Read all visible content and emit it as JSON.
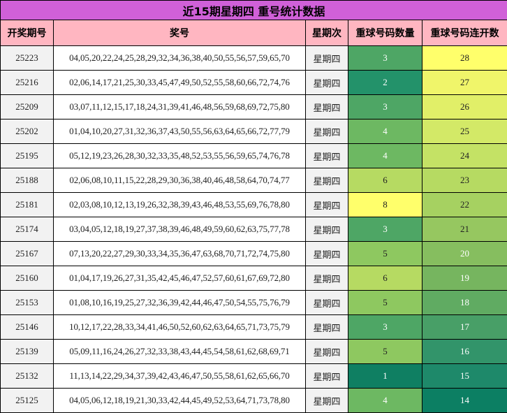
{
  "title": "近15期星期四 重号统计数据",
  "headers": [
    "开奖期号",
    "奖号",
    "星期次",
    "重球号码数量",
    "重球号码连开数"
  ],
  "rows": [
    {
      "issue": "25223",
      "numbers": "04,05,20,22,24,25,28,29,32,34,36,38,40,50,55,56,57,59,65,70",
      "day": "星期四",
      "repeat_count": "3",
      "streak": "28"
    },
    {
      "issue": "25216",
      "numbers": "02,06,14,17,21,25,30,33,45,47,49,50,52,55,58,60,66,72,74,76",
      "day": "星期四",
      "repeat_count": "2",
      "streak": "27"
    },
    {
      "issue": "25209",
      "numbers": "03,07,11,12,15,17,18,24,31,39,41,46,48,56,59,68,69,72,75,80",
      "day": "星期四",
      "repeat_count": "3",
      "streak": "26"
    },
    {
      "issue": "25202",
      "numbers": "01,04,10,20,27,31,32,36,37,43,50,55,56,63,64,65,66,72,77,79",
      "day": "星期四",
      "repeat_count": "4",
      "streak": "25"
    },
    {
      "issue": "25195",
      "numbers": "05,12,19,23,26,28,30,32,33,35,48,52,53,55,56,59,65,74,76,78",
      "day": "星期四",
      "repeat_count": "4",
      "streak": "24"
    },
    {
      "issue": "25188",
      "numbers": "02,06,08,10,11,15,22,28,29,30,36,38,40,46,48,58,64,70,74,77",
      "day": "星期四",
      "repeat_count": "6",
      "streak": "23"
    },
    {
      "issue": "25181",
      "numbers": "02,03,08,10,12,13,19,26,32,38,39,43,46,48,53,55,69,76,78,80",
      "day": "星期四",
      "repeat_count": "8",
      "streak": "22"
    },
    {
      "issue": "25174",
      "numbers": "03,04,05,12,18,19,27,37,38,39,46,48,49,59,60,62,63,75,77,78",
      "day": "星期四",
      "repeat_count": "3",
      "streak": "21"
    },
    {
      "issue": "25167",
      "numbers": "07,13,20,22,27,29,30,33,34,35,36,47,63,68,70,71,72,74,75,80",
      "day": "星期四",
      "repeat_count": "5",
      "streak": "20"
    },
    {
      "issue": "25160",
      "numbers": "01,04,17,19,26,27,31,35,42,45,46,47,52,57,60,61,67,69,72,80",
      "day": "星期四",
      "repeat_count": "6",
      "streak": "19"
    },
    {
      "issue": "25153",
      "numbers": "01,08,10,16,19,25,27,32,36,39,42,44,46,47,50,54,55,75,76,79",
      "day": "星期四",
      "repeat_count": "5",
      "streak": "18"
    },
    {
      "issue": "25146",
      "numbers": "10,12,17,22,28,33,34,41,46,50,52,60,62,63,64,65,71,73,75,79",
      "day": "星期四",
      "repeat_count": "3",
      "streak": "17"
    },
    {
      "issue": "25139",
      "numbers": "05,09,11,16,24,26,27,32,33,38,43,44,45,54,58,61,62,68,69,71",
      "day": "星期四",
      "repeat_count": "5",
      "streak": "16"
    },
    {
      "issue": "25132",
      "numbers": "11,13,14,22,29,34,37,39,42,43,46,47,50,55,58,61,62,65,66,70",
      "day": "星期四",
      "repeat_count": "1",
      "streak": "15"
    },
    {
      "issue": "25125",
      "numbers": "04,05,06,12,18,19,21,30,33,42,44,45,49,52,53,64,71,73,78,80",
      "day": "星期四",
      "repeat_count": "4",
      "streak": "14"
    }
  ],
  "colors": {
    "title_bg": "#d060d8",
    "header_bg": "#ffb6c1",
    "count_scale": {
      "1": "#0f7f62",
      "2": "#23926a",
      "3": "#4ea665",
      "4": "#6db862",
      "5": "#8ec860",
      "6": "#b6da62",
      "8": "#ffff6b"
    },
    "streak_scale": {
      "28": "#ffff6b",
      "27": "#f0f56a",
      "26": "#e1ef68",
      "25": "#d3e967",
      "24": "#c4e265",
      "23": "#b6da62",
      "22": "#a6d161",
      "21": "#96c760",
      "20": "#86be5f",
      "19": "#76b55f",
      "18": "#60ab62",
      "17": "#489f67",
      "16": "#32946a",
      "15": "#1e896a",
      "14": "#0c7f63"
    }
  }
}
